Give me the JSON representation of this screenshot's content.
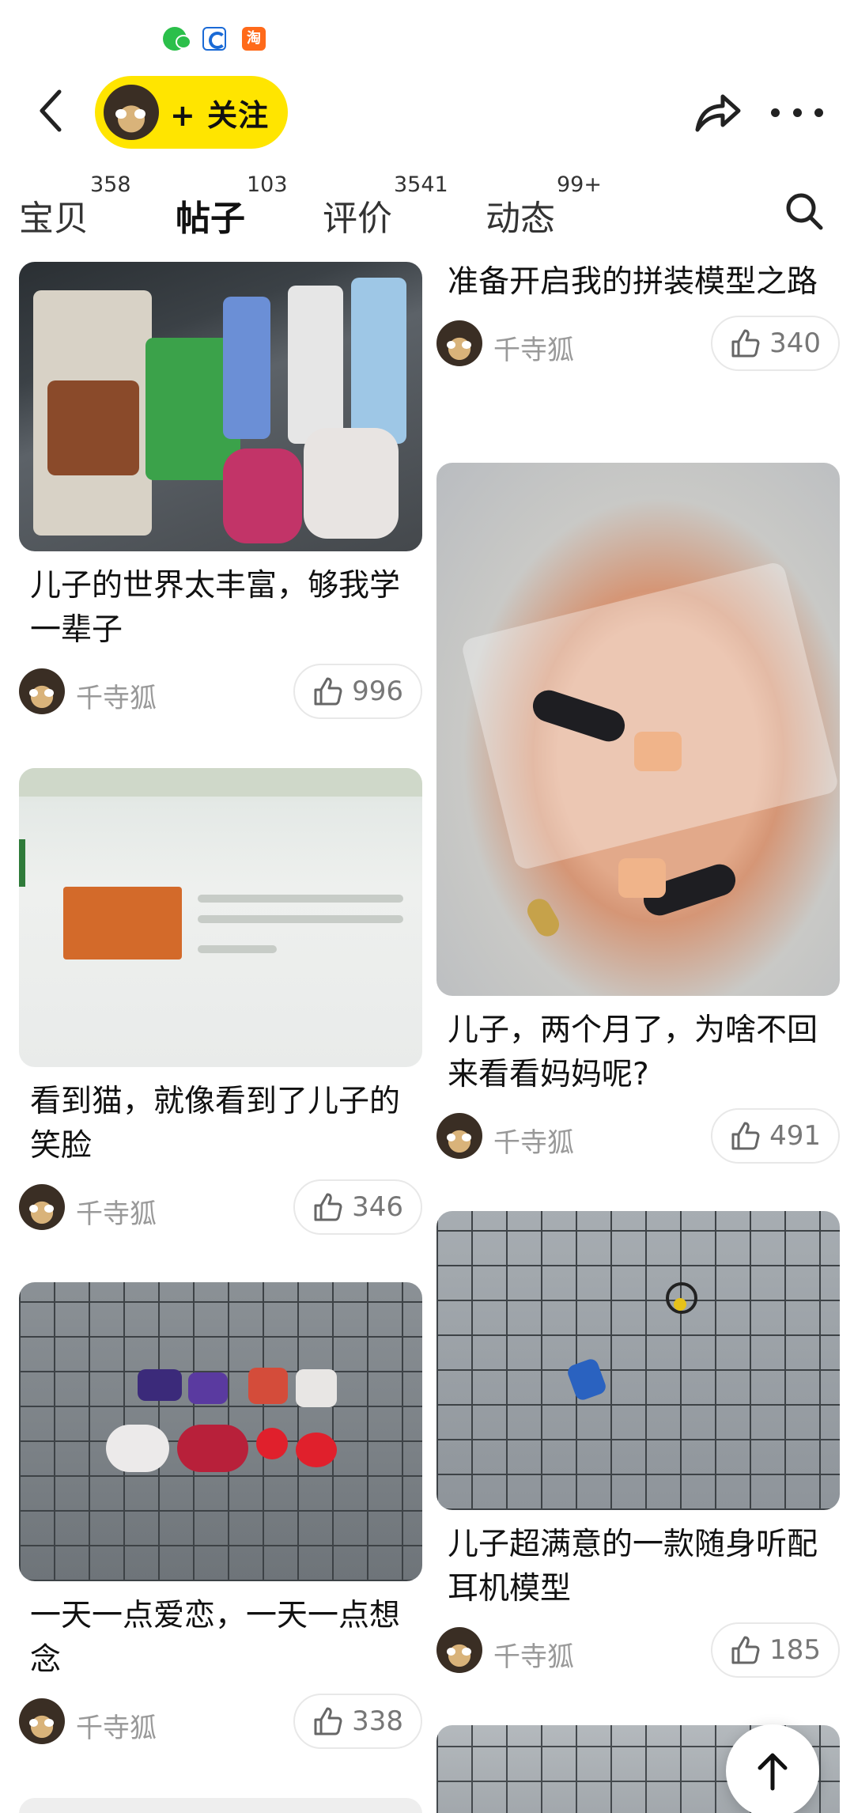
{
  "status_bar": {
    "icons": [
      "wechat-icon",
      "ctrip-icon",
      "taobao-icon"
    ],
    "taobao_glyph": "淘"
  },
  "header": {
    "follow_label": "+ 关注",
    "accent_color": "#ffe500"
  },
  "tabs": [
    {
      "label": "宝贝",
      "count": "358",
      "active": false
    },
    {
      "label": "帖子",
      "count": "103",
      "active": true
    },
    {
      "label": "评价",
      "count": "3541",
      "active": false
    },
    {
      "label": "动态",
      "count": "99+",
      "active": false
    }
  ],
  "feed": {
    "left": [
      {
        "title": "儿子的世界太丰富，够我学一辈子",
        "author": "千寺狐",
        "likes": "996"
      },
      {
        "title": "看到猫，就像看到了儿子的笑脸",
        "author": "千寺狐",
        "likes": "346"
      },
      {
        "title": "一天一点爱恋，一天一点想念",
        "author": "千寺狐",
        "likes": "338"
      }
    ],
    "right": [
      {
        "title": "准备开启我的拼装模型之路",
        "author": "千寺狐",
        "likes": "340"
      },
      {
        "title": "儿子，两个月了，为啥不回来看看妈妈呢?",
        "author": "千寺狐",
        "likes": "491"
      },
      {
        "title": "儿子超满意的一款随身听配耳机模型",
        "author": "千寺狐",
        "likes": "185"
      }
    ]
  }
}
